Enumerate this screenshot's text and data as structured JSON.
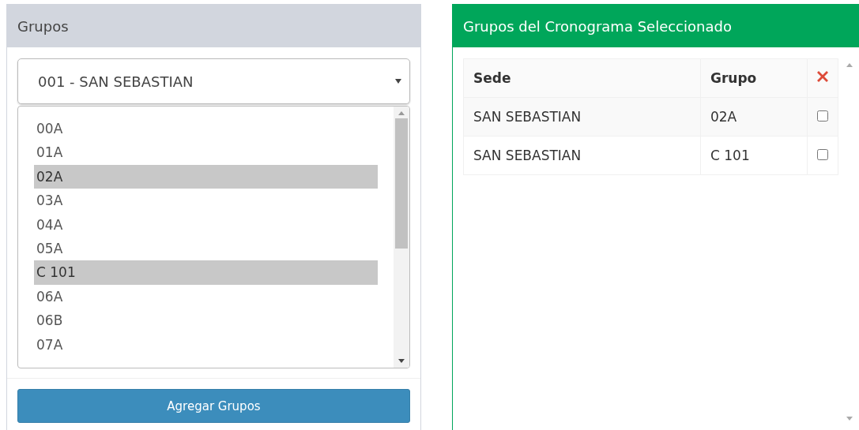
{
  "left_panel": {
    "title": "Grupos",
    "sede_select": {
      "value": "001 - SAN SEBASTIAN"
    },
    "groups_list": [
      {
        "label": "00A",
        "selected": false
      },
      {
        "label": "01A",
        "selected": false
      },
      {
        "label": "02A",
        "selected": true
      },
      {
        "label": "03A",
        "selected": false
      },
      {
        "label": "04A",
        "selected": false
      },
      {
        "label": "05A",
        "selected": false
      },
      {
        "label": "C 101",
        "selected": true
      },
      {
        "label": "06A",
        "selected": false
      },
      {
        "label": "06B",
        "selected": false
      },
      {
        "label": "07A",
        "selected": false
      }
    ],
    "add_button": "Agregar Grupos"
  },
  "right_panel": {
    "title": "Grupos del Cronograma Seleccionado",
    "table": {
      "columns": [
        "Sede",
        "Grupo"
      ],
      "rows": [
        {
          "sede": "SAN SEBASTIAN",
          "grupo": "02A",
          "checked": false
        },
        {
          "sede": "SAN SEBASTIAN",
          "grupo": "C 101",
          "checked": false
        }
      ]
    }
  }
}
